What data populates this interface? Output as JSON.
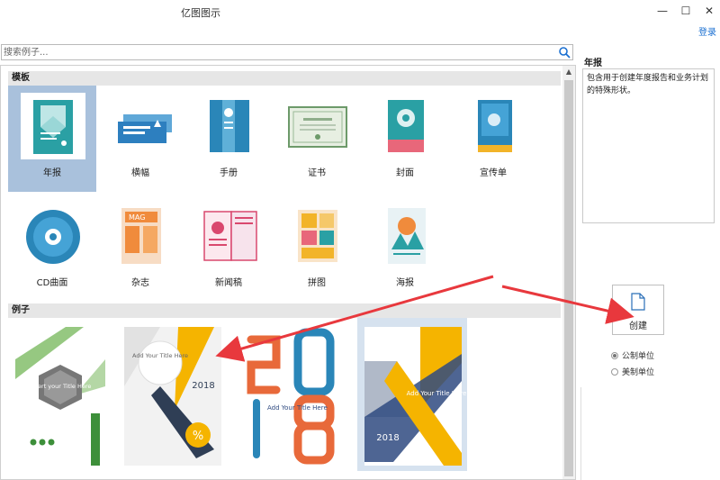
{
  "window": {
    "title": "亿图图示",
    "minimize": "—",
    "maximize": "☐",
    "close": "✕",
    "login": "登录"
  },
  "search": {
    "placeholder": "搜索例子...",
    "value": ""
  },
  "templates_section": {
    "header": "模板",
    "items": [
      {
        "label": "年报",
        "icon": "annual-report-icon",
        "selected": true
      },
      {
        "label": "横幅",
        "icon": "banner-icon"
      },
      {
        "label": "手册",
        "icon": "brochure-icon"
      },
      {
        "label": "证书",
        "icon": "certificate-icon"
      },
      {
        "label": "封面",
        "icon": "cover-icon"
      },
      {
        "label": "宣传单",
        "icon": "flyer-icon"
      },
      {
        "label": "CD曲面",
        "icon": "cd-icon"
      },
      {
        "label": "杂志",
        "icon": "magazine-icon"
      },
      {
        "label": "新闻稿",
        "icon": "newsletter-icon"
      },
      {
        "label": "拼图",
        "icon": "collage-icon"
      },
      {
        "label": "海报",
        "icon": "poster-icon"
      }
    ]
  },
  "examples_section": {
    "header": "例子",
    "items": [
      {
        "text": "Insert your Title Here",
        "icon": "green-hexagon-report"
      },
      {
        "text": "Add Your Title Here",
        "year": "2018",
        "badge": "%",
        "icon": "yellow-gray-report"
      },
      {
        "text": "Add Your Title Here",
        "year": "2018",
        "icon": "number-2018-report"
      },
      {
        "text": "Add Your Title Here",
        "year": "2018",
        "icon": "yellow-blue-x-report",
        "selected": true
      }
    ]
  },
  "details": {
    "title": "年报",
    "description": "包含用于创建年度报告和业务计划的特殊形状。"
  },
  "create_button": {
    "label": "创建",
    "icon": "new-document-icon"
  },
  "units": {
    "metric": "公制单位",
    "imperial": "美制单位",
    "selected": "metric"
  },
  "colors": {
    "selection": "#a9c1dc",
    "accent_red": "#e8383d",
    "teal": "#2aa0a4",
    "yellow": "#f5b400",
    "navy": "#2f4a80"
  }
}
